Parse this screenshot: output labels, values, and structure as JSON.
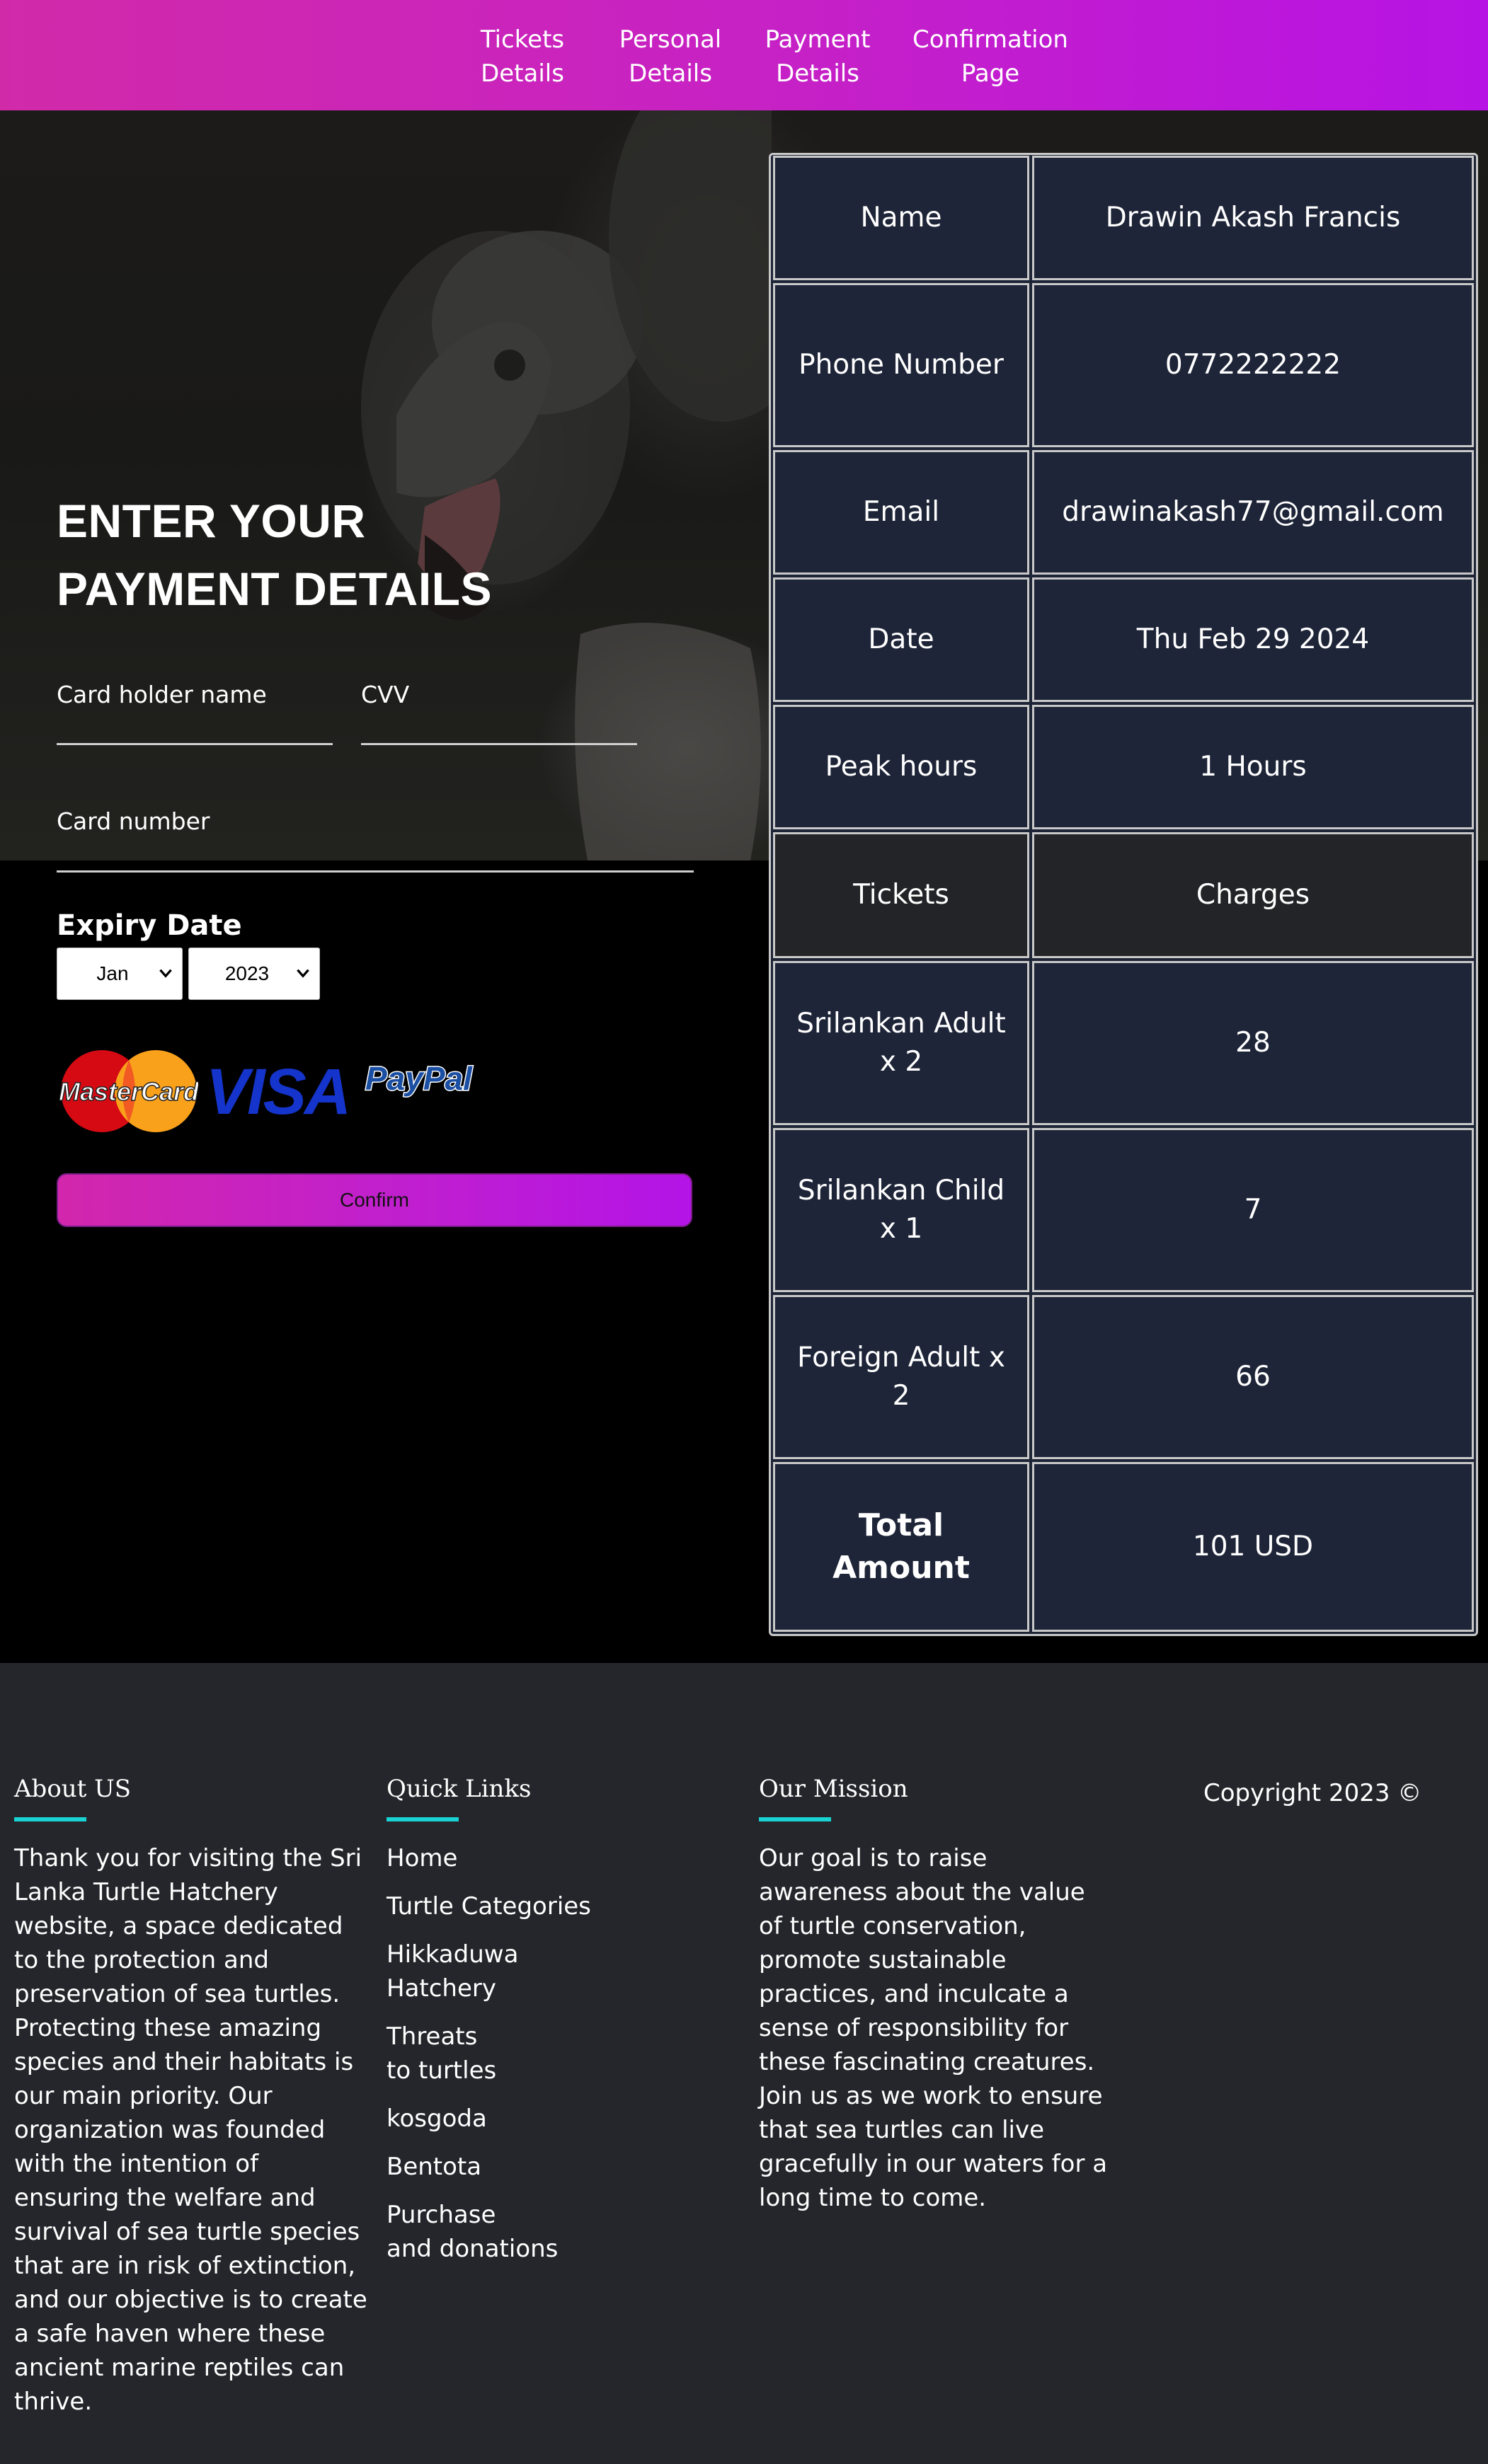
{
  "nav": {
    "items": [
      {
        "label": "Tickets\nDetails"
      },
      {
        "label": "Personal\nDetails"
      },
      {
        "label": "Payment\nDetails"
      },
      {
        "label": "Confirmation\nPage"
      }
    ]
  },
  "payment": {
    "title": "ENTER YOUR PAYMENT DETAILS",
    "card_holder_label": "Card holder name",
    "cvv_label": "CVV",
    "card_number_label": "Card number",
    "expiry_label": "Expiry Date",
    "month_value": "Jan",
    "year_value": "2023",
    "logos": {
      "mastercard": "MasterCard",
      "visa": "VISA",
      "paypal": "PayPal"
    },
    "confirm_label": "Confirm"
  },
  "summary": {
    "rows": [
      {
        "label": "Name",
        "value": "Drawin Akash Francis"
      },
      {
        "label": "Phone Number",
        "value": "0772222222"
      },
      {
        "label": "Email",
        "value": "drawinakash77@gmail.com"
      },
      {
        "label": "Date",
        "value": "Thu Feb 29 2024"
      },
      {
        "label": "Peak hours",
        "value": "1 Hours"
      },
      {
        "label": "Tickets",
        "value": "Charges"
      },
      {
        "label": "Srilankan Adult x 2",
        "value": "28"
      },
      {
        "label": "Srilankan Child x 1",
        "value": "7"
      },
      {
        "label": "Foreign Adult x 2",
        "value": "66"
      },
      {
        "label": "Total Amount",
        "value": "101 USD"
      }
    ]
  },
  "footer": {
    "about": {
      "heading": "About US",
      "text": "Thank you for visiting the Sri Lanka Turtle Hatchery website, a space dedicated to the protection and preservation of sea turtles. Protecting these amazing species and their habitats is our main priority. Our organization was founded with the intention of ensuring the welfare and survival of sea turtle species that are in risk of extinction, and our objective is to create a safe haven where these ancient marine reptiles can thrive."
    },
    "quick_links": {
      "heading": "Quick Links",
      "links": [
        "Home",
        "Turtle Categories",
        "Hikkaduwa\nHatchery",
        "Threats\nto turtles",
        "kosgoda",
        "Bentota",
        "Purchase\nand donations"
      ]
    },
    "mission": {
      "heading": "Our Mission",
      "text": "Our goal is to raise awareness about the value of turtle conservation, promote sustainable practices, and inculcate a sense of responsibility for these fascinating creatures. Join us as we work to ensure that sea turtles can live gracefully in our waters for a long time to come."
    },
    "copyright": "Copyright 2023 ©"
  },
  "colors": {
    "nav_gradient_start": "#d12aa9",
    "nav_gradient_end": "#b713e4",
    "table_bg": "#1e2538",
    "footer_bg": "#24262b",
    "footer_accent": "#19d2d2"
  }
}
